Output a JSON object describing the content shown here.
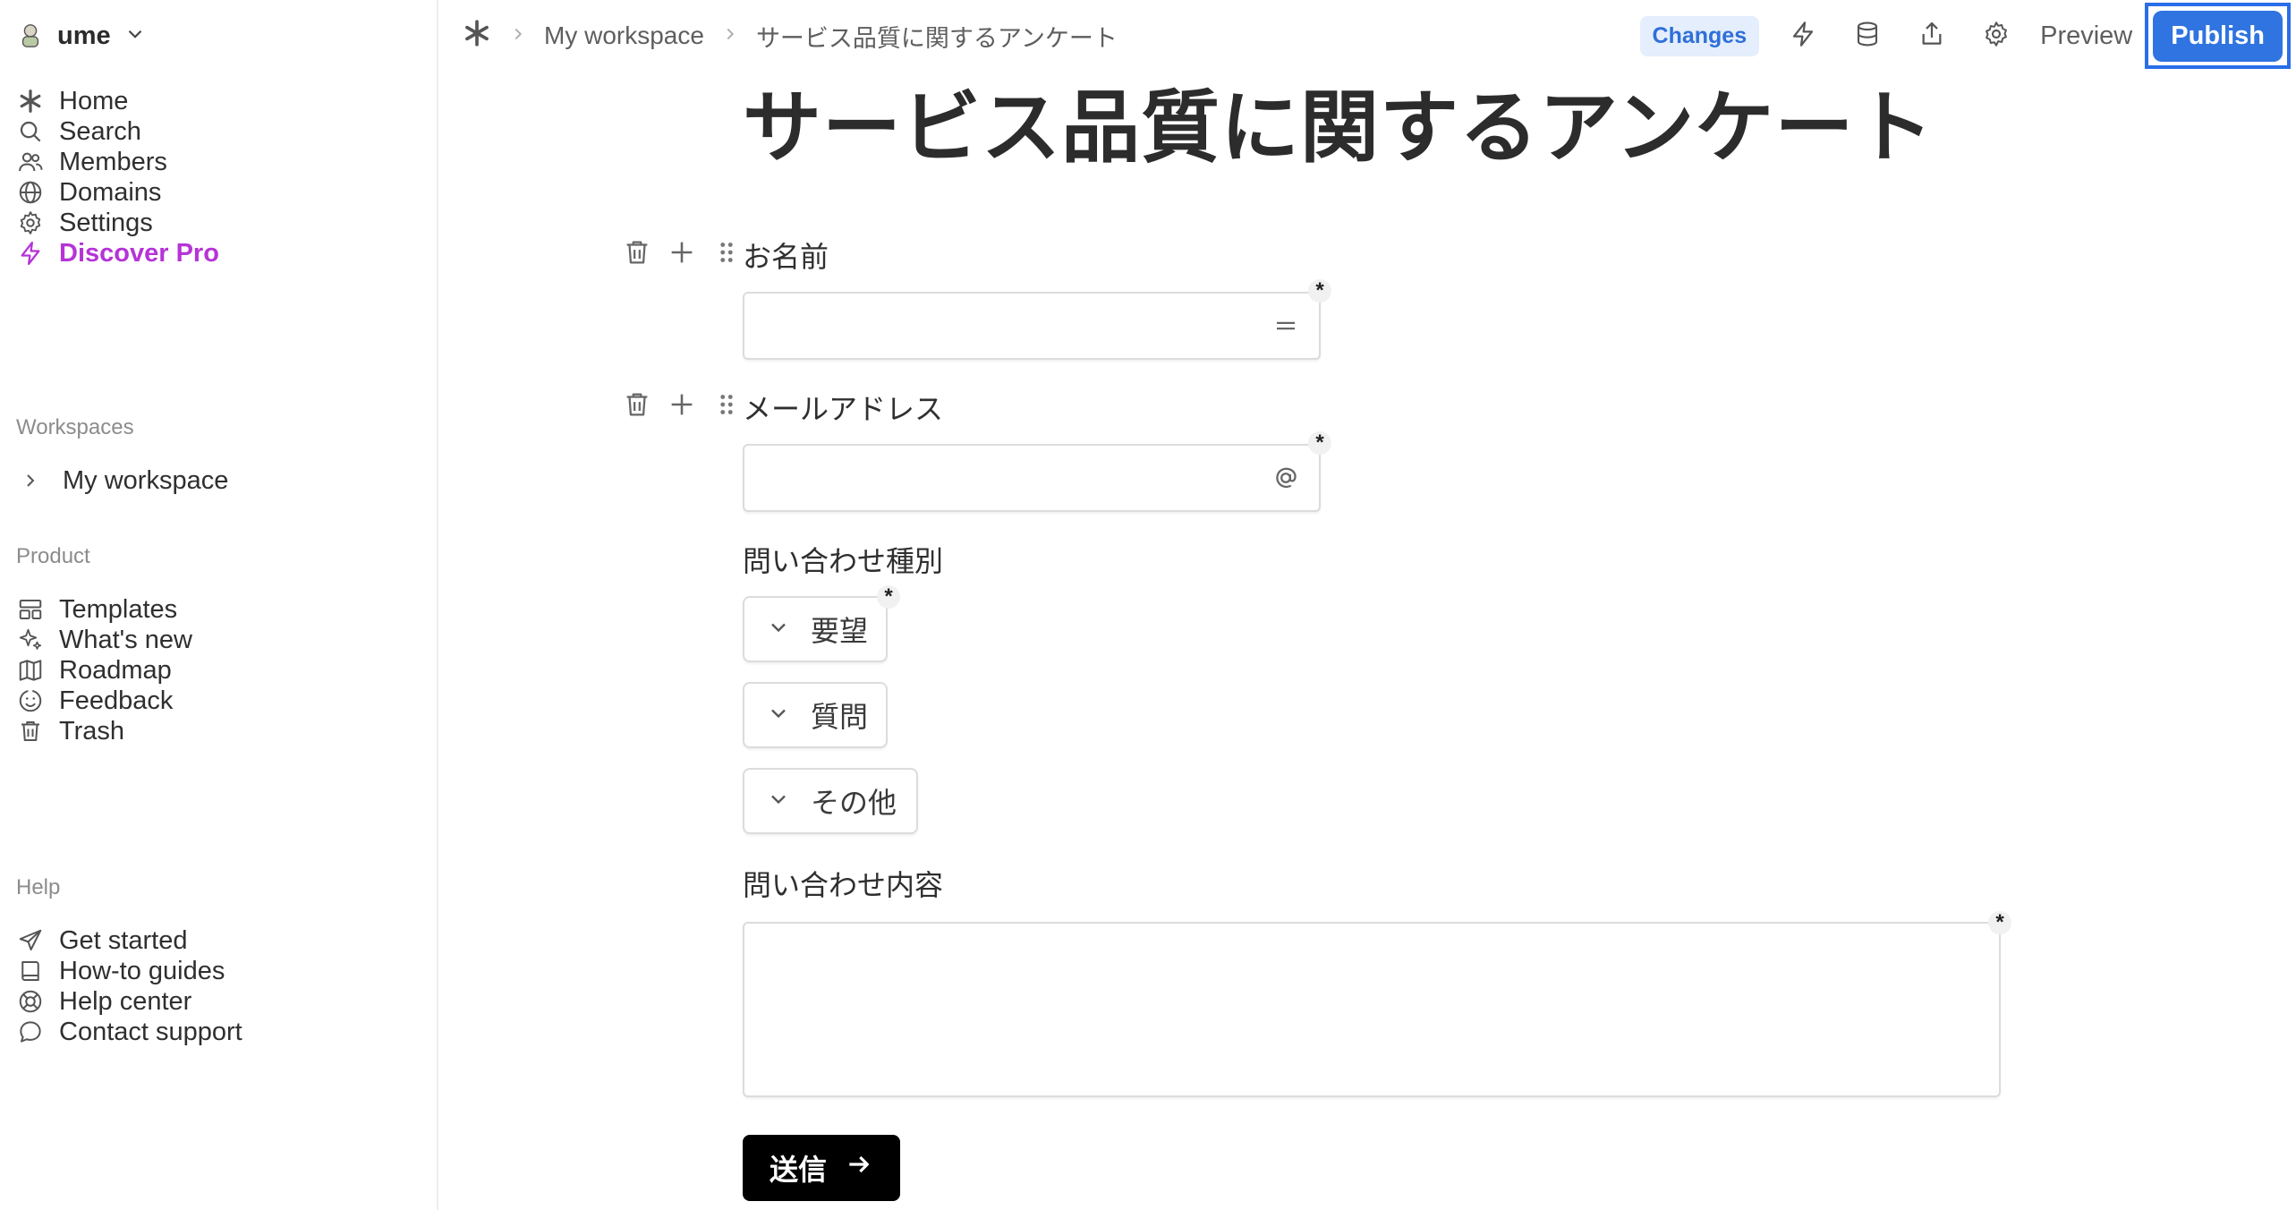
{
  "workspace": {
    "name": "ume"
  },
  "sidebar": {
    "main": [
      {
        "label": "Home",
        "icon": "asterisk-icon"
      },
      {
        "label": "Search",
        "icon": "search-icon"
      },
      {
        "label": "Members",
        "icon": "members-icon"
      },
      {
        "label": "Domains",
        "icon": "globe-icon"
      },
      {
        "label": "Settings",
        "icon": "gear-icon"
      },
      {
        "label": "Discover Pro",
        "icon": "lightning-icon"
      }
    ],
    "workspaces_label": "Workspaces",
    "workspace_item": "My workspace",
    "product_label": "Product",
    "product": [
      {
        "label": "Templates",
        "icon": "templates-icon"
      },
      {
        "label": "What's new",
        "icon": "sparkles-icon"
      },
      {
        "label": "Roadmap",
        "icon": "map-icon"
      },
      {
        "label": "Feedback",
        "icon": "smiley-icon"
      },
      {
        "label": "Trash",
        "icon": "trash-icon"
      }
    ],
    "help_label": "Help",
    "help": [
      {
        "label": "Get started",
        "icon": "send-icon"
      },
      {
        "label": "How-to guides",
        "icon": "book-icon"
      },
      {
        "label": "Help center",
        "icon": "lifebuoy-icon"
      },
      {
        "label": "Contact support",
        "icon": "chat-icon"
      }
    ]
  },
  "topbar": {
    "breadcrumb": [
      "My workspace",
      "サービス品質に関するアンケート"
    ],
    "changes_label": "Changes",
    "preview_label": "Preview",
    "publish_label": "Publish"
  },
  "form": {
    "title": "サービス品質に関するアンケート",
    "questions": [
      {
        "label": "お名前",
        "type": "text",
        "required_mark": "*"
      },
      {
        "label": "メールアドレス",
        "type": "email",
        "required_mark": "*"
      },
      {
        "label": "問い合わせ種別",
        "type": "choice",
        "required_mark": "*",
        "options": [
          "要望",
          "質問",
          "その他"
        ]
      },
      {
        "label": "問い合わせ内容",
        "type": "textarea",
        "required_mark": "*"
      }
    ],
    "submit_label": "送信"
  },
  "colors": {
    "accent": "#2f74e0",
    "pro": "#b534d6",
    "changes_bg": "#e4eefc",
    "submit_bg": "#000000"
  }
}
